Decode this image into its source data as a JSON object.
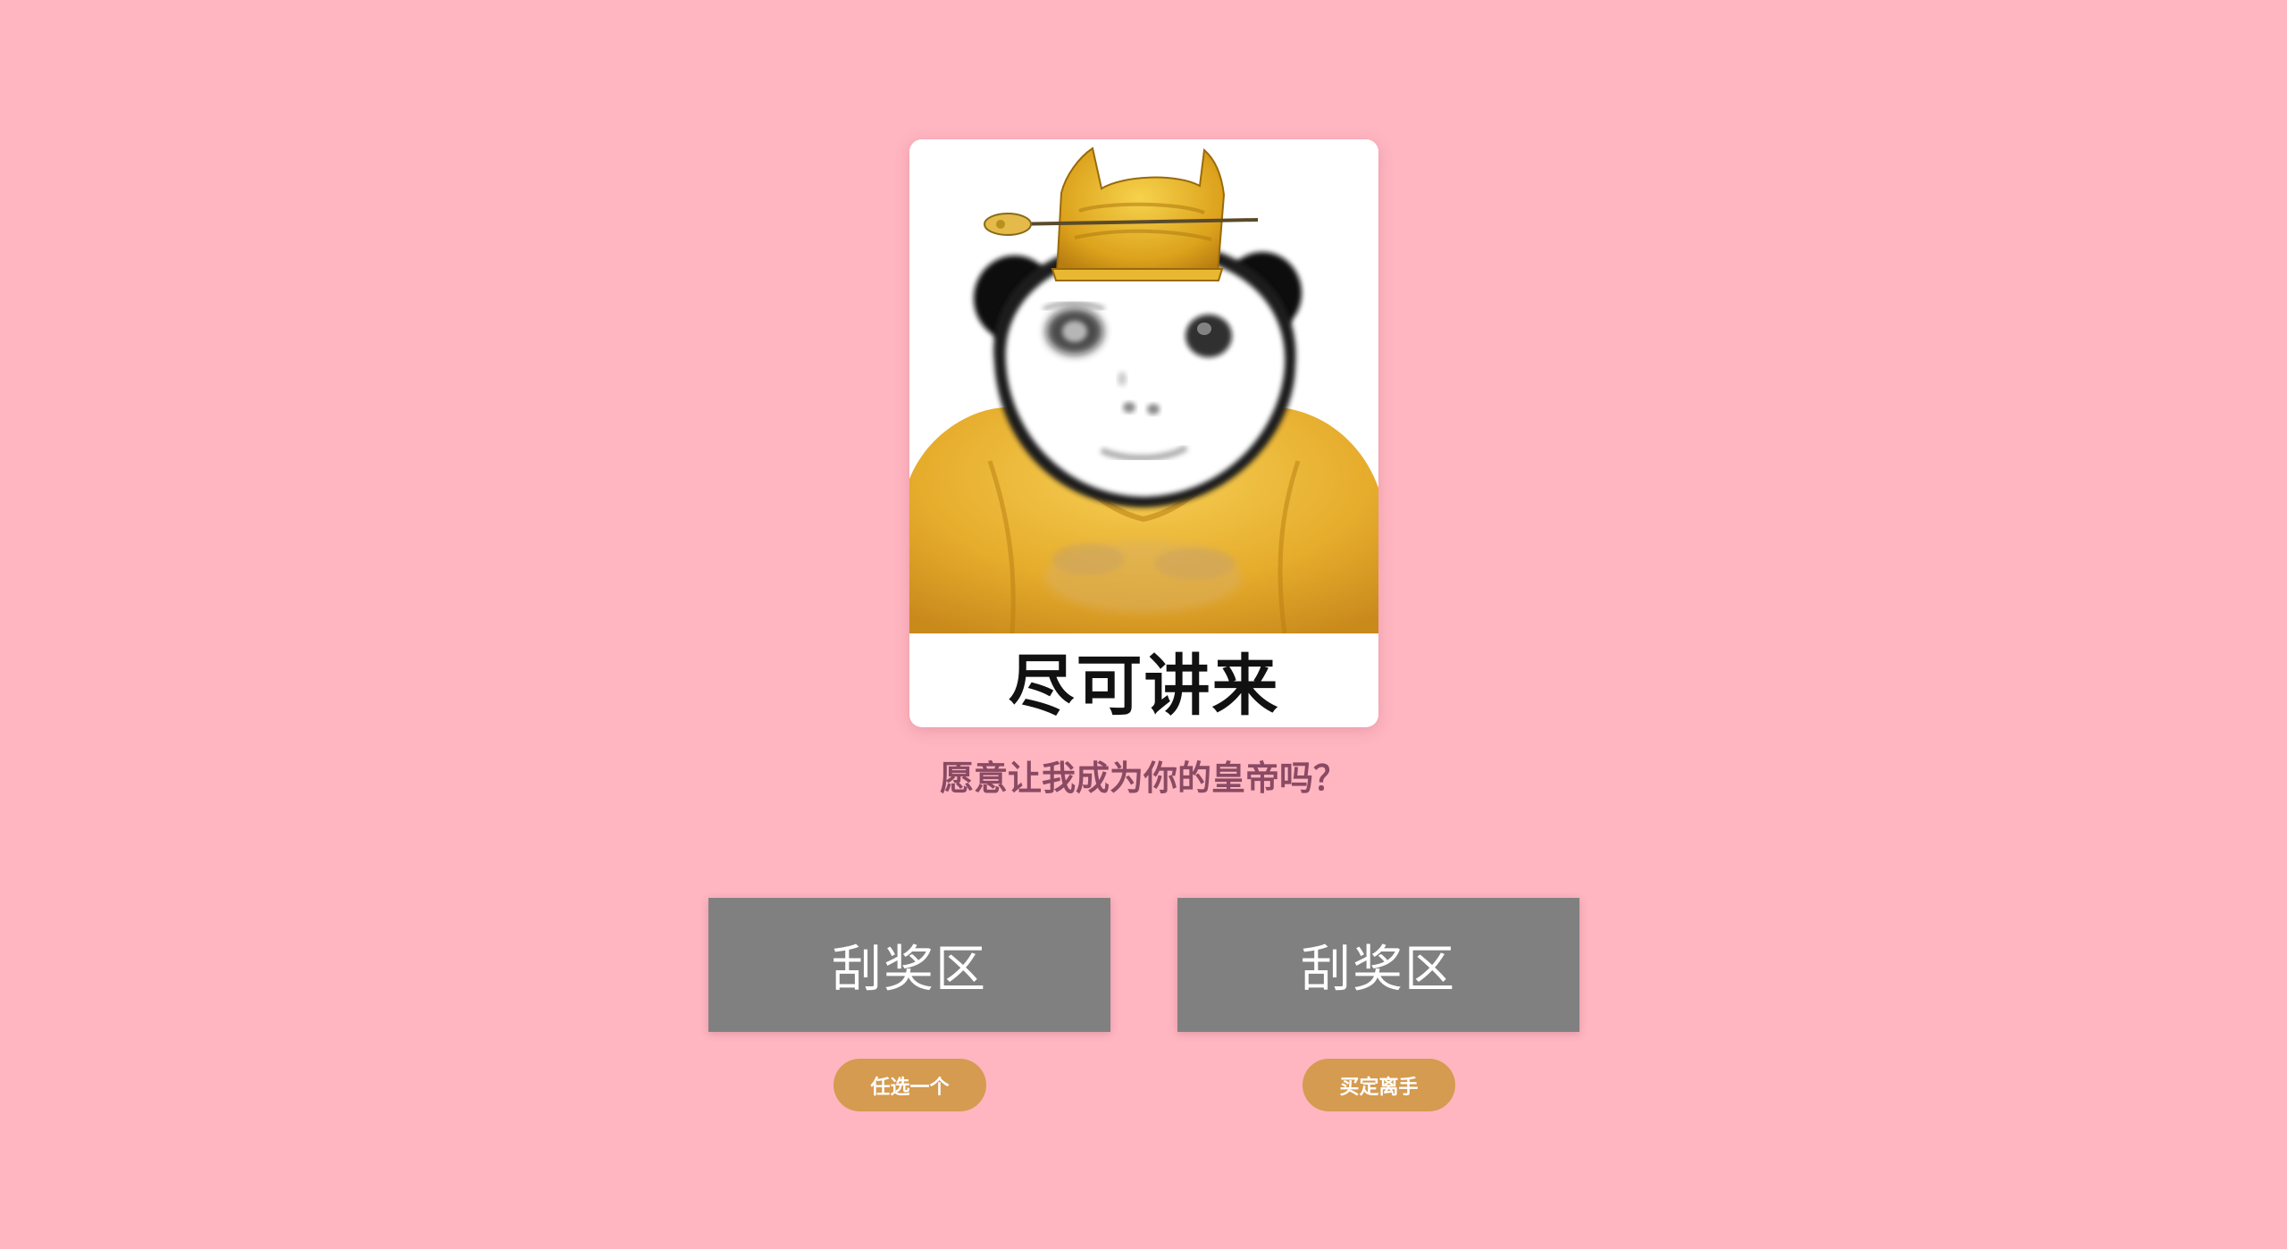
{
  "meme": {
    "caption": "尽可讲来",
    "image_subject": "panda-emperor-icon"
  },
  "question": "愿意让我成为你的皇帝吗？",
  "scratch_cards": [
    {
      "label": "刮奖区",
      "button": "任选一个"
    },
    {
      "label": "刮奖区",
      "button": "买定离手"
    }
  ],
  "colors": {
    "background": "#ffb6c1",
    "scratch_cover": "#808080",
    "button": "#d59b50",
    "question_text": "#8a4a63"
  }
}
